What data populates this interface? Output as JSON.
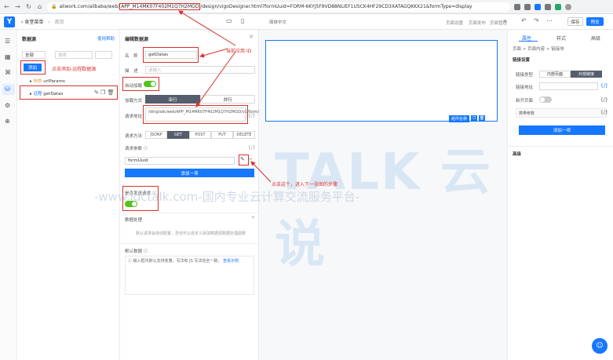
{
  "browser": {
    "url_prefix": "aliwork.com/alibaba/web/",
    "url_app_id": "APP_M14MK07F402M1Q7H2MGD",
    "url_suffix": "/design/vigoDesigner.html?formUuid=FORM-6KYJ5F9VD88NLIEF1USCK4HF29CD3XATAGQKKX21&formType=display"
  },
  "appbar": {
    "crumb_app": "食堂菜单",
    "crumb_page": "首页",
    "lang": "简体中文",
    "menu_1": "页面设置",
    "menu_2": "页面发布",
    "menu_3": "页面管理",
    "save_label": "保存",
    "preview_label": "预览"
  },
  "datasource": {
    "title": "数据源",
    "help": "使用帮助",
    "filter_value": "全部",
    "search_placeholder": "搜索",
    "add_label": "添加",
    "add_tip": "点击添加-远程数据源",
    "item1_tag": "参数",
    "item1_name": "urlParams",
    "item2_tag": "远程",
    "item2_name": "getDatas"
  },
  "editor": {
    "title": "编辑数据源",
    "name_label": "名　称",
    "name_value": "getDatas",
    "desc_label": "描　述",
    "desc_placeholder": "请输入",
    "auto_load_label": "自动加载",
    "load_mode_label": "加载方式",
    "load_mode_serial": "串行",
    "load_mode_parallel": "并行",
    "url_label": "请求地址",
    "url_value": "/dingtalk/web/APP_M14MK07F402M1Q7H2MGD/v1/form/searchFormDatas.json",
    "fx": "{/}",
    "method_label": "请求方法",
    "methods": [
      "JSONP",
      "GET",
      "POST",
      "PUT",
      "DELETE"
    ],
    "params_label": "请求参数",
    "param_value": "formUuid",
    "add_one": "添加一项",
    "send_label": "是否发送请求",
    "handlers_label": "数据处理",
    "handlers_desc": "默认请求会自动配置，您也可以自定义添加数据源数据处理函数",
    "default_label": "默认数据",
    "default_hint": "输入框内默认支持变量，写法和 JS 写法完全一致。",
    "default_link": "查看示例"
  },
  "canvas": {
    "comp_label": "组件名称"
  },
  "right": {
    "tab_props": "属性",
    "tab_style": "样式",
    "tab_advanced": "高级",
    "crumb": "页面 > 页面内容 > 链接块",
    "section_link": "链接设置",
    "link_type_label": "链接类型",
    "link_internal": "内部页面",
    "link_external": "外部链接",
    "link_addr_label": "链接地址",
    "new_window_label": "新开页面",
    "carry_params": "携带参数",
    "add_one": "添加一项",
    "section_advanced": "高级"
  },
  "annotations": {
    "app_id": "当前应用 ID",
    "next_step": "点击这个，进入下一张图的步骤"
  },
  "watermark": {
    "big": "TALK 云说",
    "small": "-www.idctalk.com-国内专业云计算交流服务平台-"
  }
}
